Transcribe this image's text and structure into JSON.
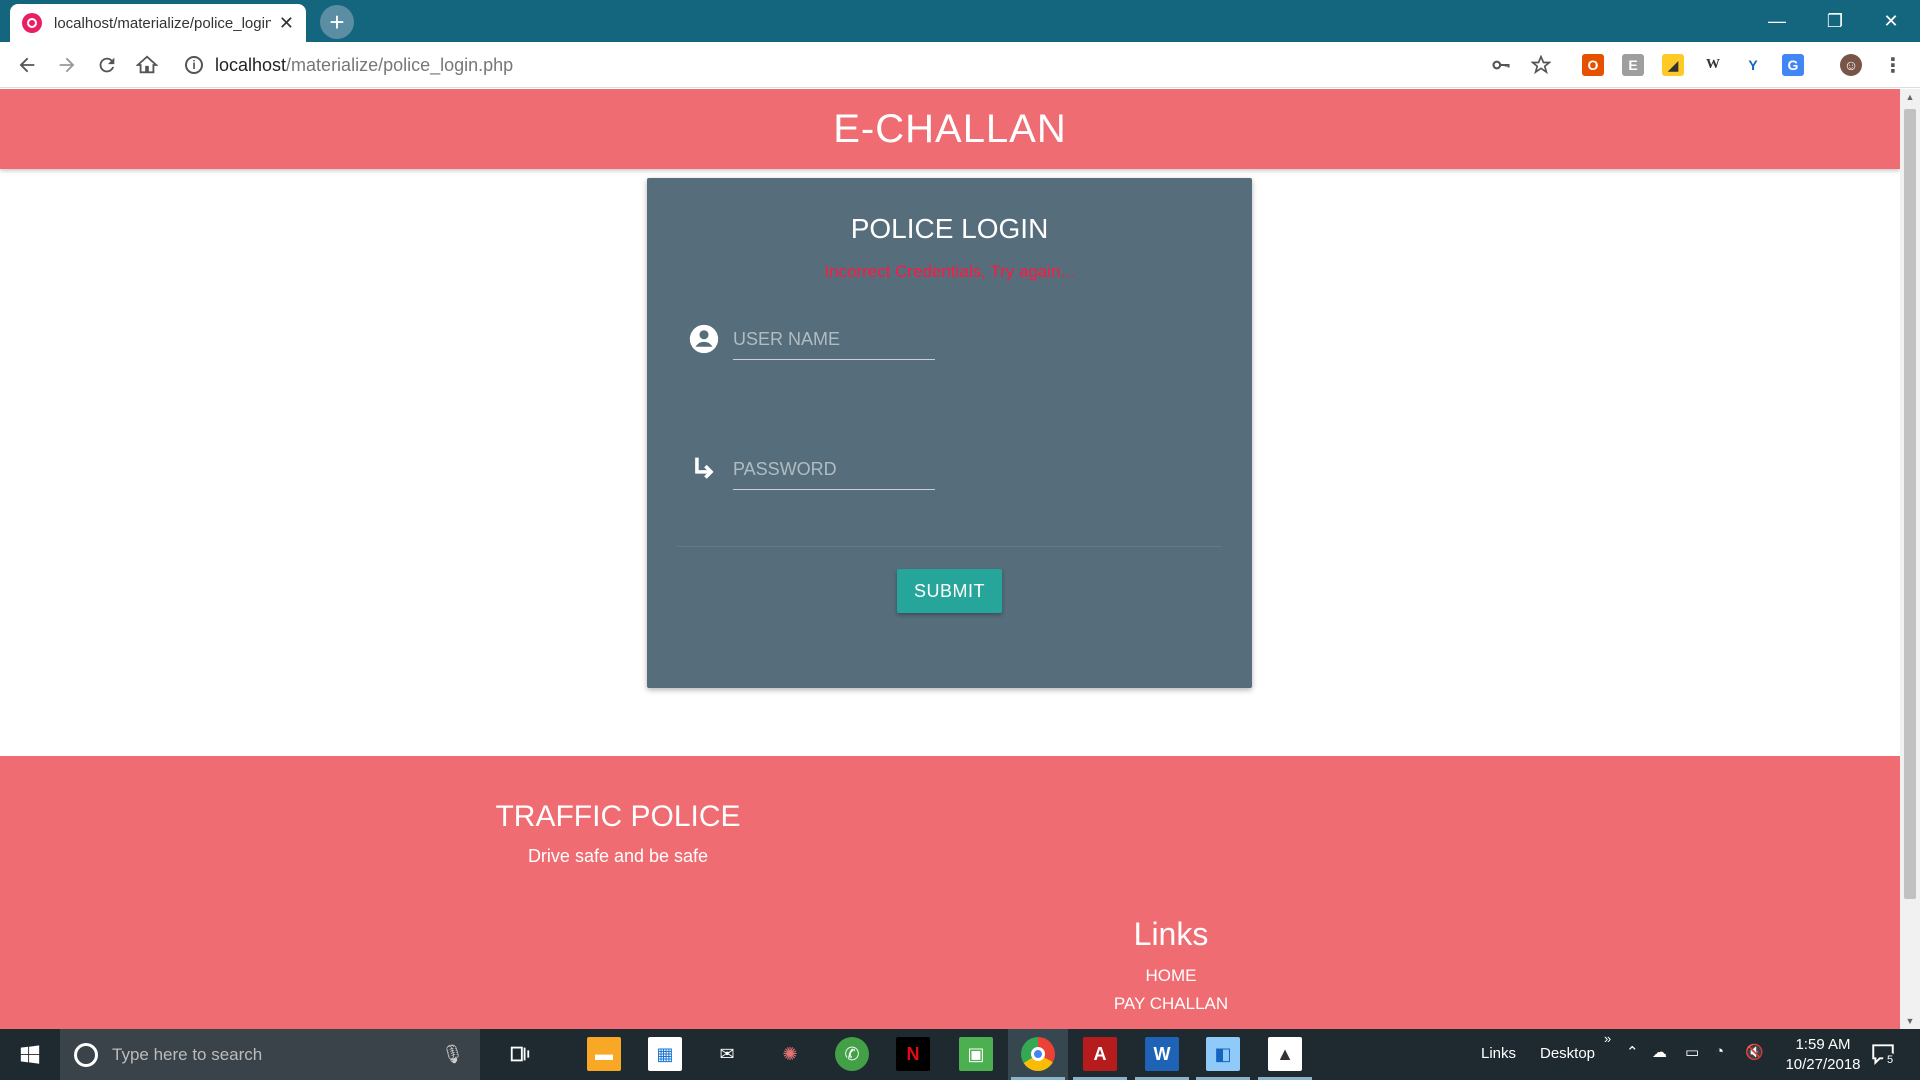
{
  "browser": {
    "tab_title": "localhost/materialize/police_login",
    "tab_close": "✕",
    "new_tab": "+",
    "url_host": "localhost",
    "url_path": "/materialize/police_login.php",
    "minimize": "—",
    "restore": "❐",
    "close": "✕"
  },
  "page": {
    "brand": "E-CHALLAN",
    "login": {
      "title": "POLICE LOGIN",
      "error": "Incorrect Credentials, Try again...",
      "username_placeholder": "USER NAME",
      "password_placeholder": "PASSWORD",
      "submit": "SUBMIT"
    },
    "footer": {
      "title": "TRAFFIC POLICE",
      "tagline": "Drive safe and be safe",
      "links_title": "Links",
      "links": [
        "HOME",
        "PAY CHALLAN"
      ]
    }
  },
  "taskbar": {
    "search_placeholder": "Type here to search",
    "links_label": "Links",
    "desktop_label": "Desktop",
    "time": "1:59 AM",
    "date": "10/27/2018",
    "notification_count": "5"
  },
  "colors": {
    "header": "#ef6c72",
    "card": "#566e7b",
    "submit": "#26a69a",
    "error": "#ff1744",
    "titlebar": "#14667f"
  }
}
